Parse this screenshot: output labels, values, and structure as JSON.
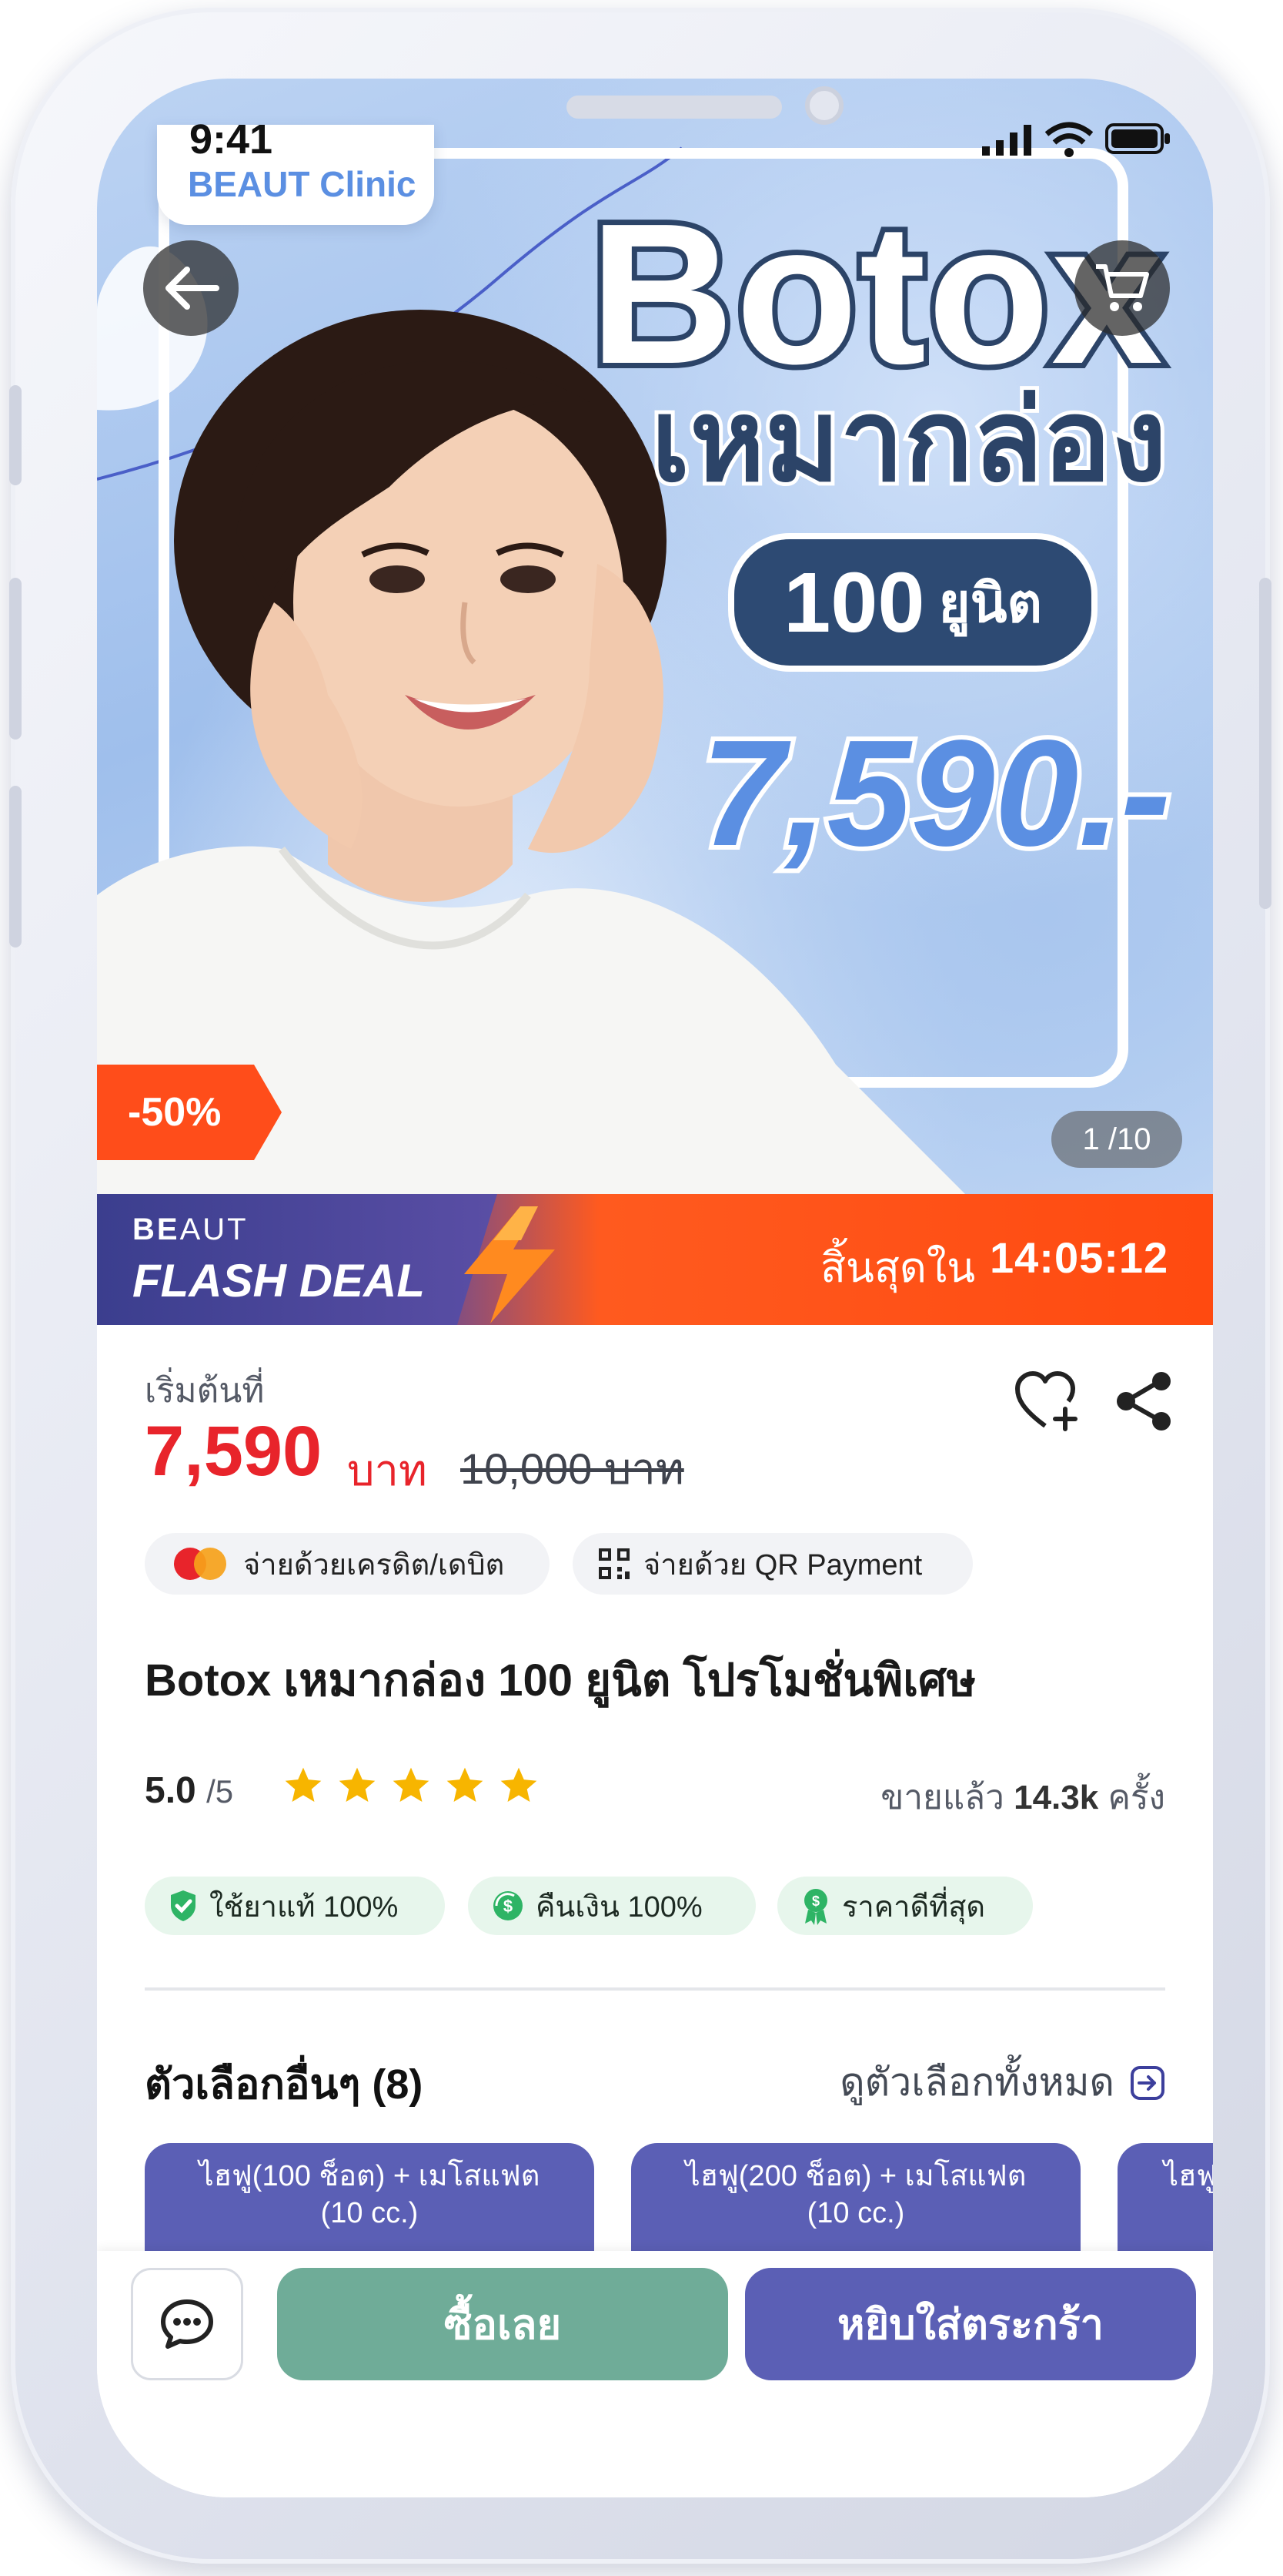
{
  "status_bar": {
    "time": "9:41"
  },
  "hero": {
    "brand": "BEAUT Clinic",
    "title": "Botox",
    "subtitle": "เหมากล่อง",
    "units_number": "100",
    "units_label": "ยูนิต",
    "promo_price": "7,590.-",
    "discount": "-50%",
    "pager": "1 /10"
  },
  "flash_deal": {
    "brand_bold": "BE",
    "brand_rest": "AUT",
    "title": "FLASH DEAL",
    "ends_label": "สิ้นสุดใน",
    "countdown": "14:05:12"
  },
  "price": {
    "starting_label": "เริ่มต้นที่",
    "current": "7,590",
    "currency": "บาท",
    "original": "10,000 บาท"
  },
  "payment": {
    "card_label": "จ่ายด้วยเครดิต/เดบิต",
    "qr_label": "จ่ายด้วย QR Payment"
  },
  "product": {
    "title": "Botox เหมากล่อง 100 ยูนิต โปรโมชั่นพิเศษ",
    "rating": "5.0",
    "rating_max": "/5",
    "stars": 5,
    "sold_label": "ขายแล้ว",
    "sold_count": "14.3k",
    "sold_unit": "ครั้ง"
  },
  "badges": [
    {
      "label": "ใช้ยาแท้ 100%",
      "icon": "shield-check-icon"
    },
    {
      "label": "คืนเงิน 100%",
      "icon": "money-back-icon"
    },
    {
      "label": "ราคาดีที่สุด",
      "icon": "best-price-icon"
    }
  ],
  "options": {
    "title": "ตัวเลือกอื่นๆ (8)",
    "view_all": "ดูตัวเลือกทั้งหมด",
    "items": [
      {
        "line1": "ไฮฟู(100 ช็อต) + เมโสแฟต",
        "line2": "(10 cc.)"
      },
      {
        "line1": "ไฮฟู(200 ช็อต) + เมโสแฟต",
        "line2": "(10 cc.)"
      },
      {
        "line1": "ไฮฟู",
        "line2": ""
      }
    ]
  },
  "actions": {
    "buy_now": "ซื้อเลย",
    "add_to_cart": "หยิบใส่ตระกร้า"
  },
  "colors": {
    "price_red": "#e8242b",
    "accent_purple": "#5b5fb5",
    "buy_green": "#6fac98",
    "flash_orange": "#ff4a10"
  }
}
